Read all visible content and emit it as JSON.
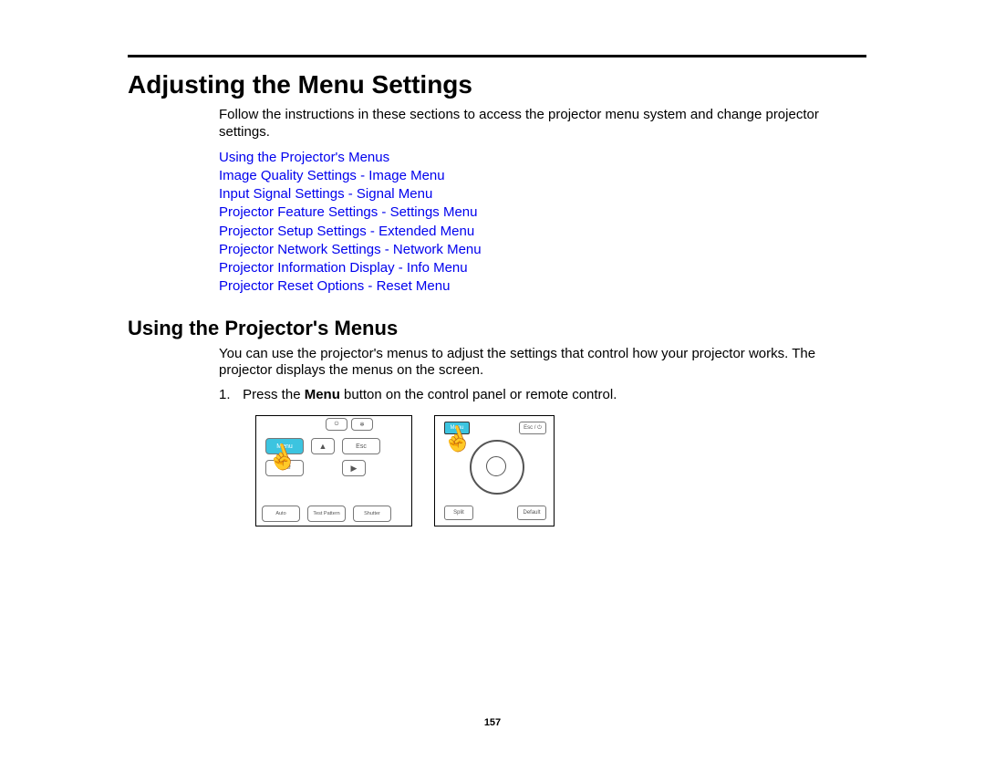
{
  "heading": "Adjusting the Menu Settings",
  "intro": "Follow the instructions in these sections to access the projector menu system and change projector settings.",
  "links": [
    "Using the Projector's Menus",
    "Image Quality Settings - Image Menu",
    "Input Signal Settings - Signal Menu",
    "Projector Feature Settings - Settings Menu",
    "Projector Setup Settings - Extended Menu",
    "Projector Network Settings - Network Menu",
    "Projector Information Display - Info Menu",
    "Projector Reset Options - Reset Menu"
  ],
  "section2_heading": "Using the Projector's Menus",
  "section2_intro": "You can use the projector's menus to adjust the settings that control how your projector works. The projector displays the menus on the screen.",
  "step1_num": "1.",
  "step1_pre": "Press the ",
  "step1_bold": "Menu",
  "step1_post": " button on the control panel or remote control.",
  "panel": {
    "menu": "Menu",
    "esc": "Esc",
    "enter": "Enter",
    "auto": "Auto",
    "test": "Test Pattern",
    "shutter": "Shutter"
  },
  "remote": {
    "menu": "Menu",
    "esc": "Esc / ⏻",
    "split": "Split",
    "default": "Default"
  },
  "arrows": {
    "up": "▲",
    "right": "▶"
  },
  "page_number": "157"
}
